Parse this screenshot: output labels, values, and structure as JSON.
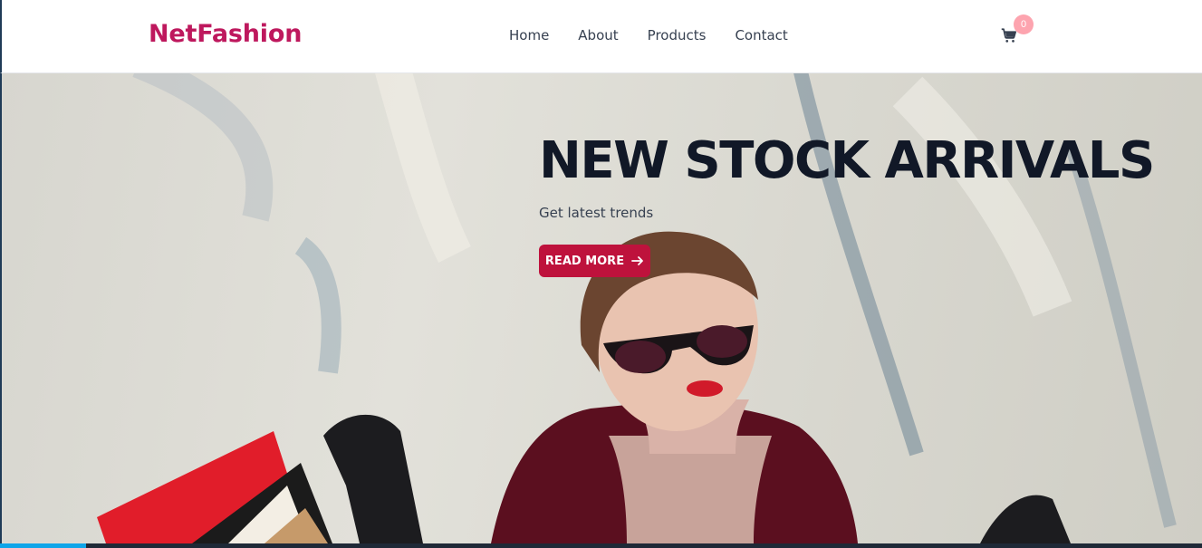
{
  "brand": {
    "name": "NetFashion",
    "color": "#be185d"
  },
  "nav": {
    "items": [
      {
        "label": "Home"
      },
      {
        "label": "About"
      },
      {
        "label": "Products"
      },
      {
        "label": "Contact"
      }
    ]
  },
  "cart": {
    "icon": "cart-icon",
    "count": "0"
  },
  "hero": {
    "title": "NEW STOCK ARRIVALS",
    "subtitle": "Get latest trends",
    "cta_label": "READ MORE",
    "cta_icon": "arrow-right-icon",
    "cta_color": "#be123c"
  }
}
